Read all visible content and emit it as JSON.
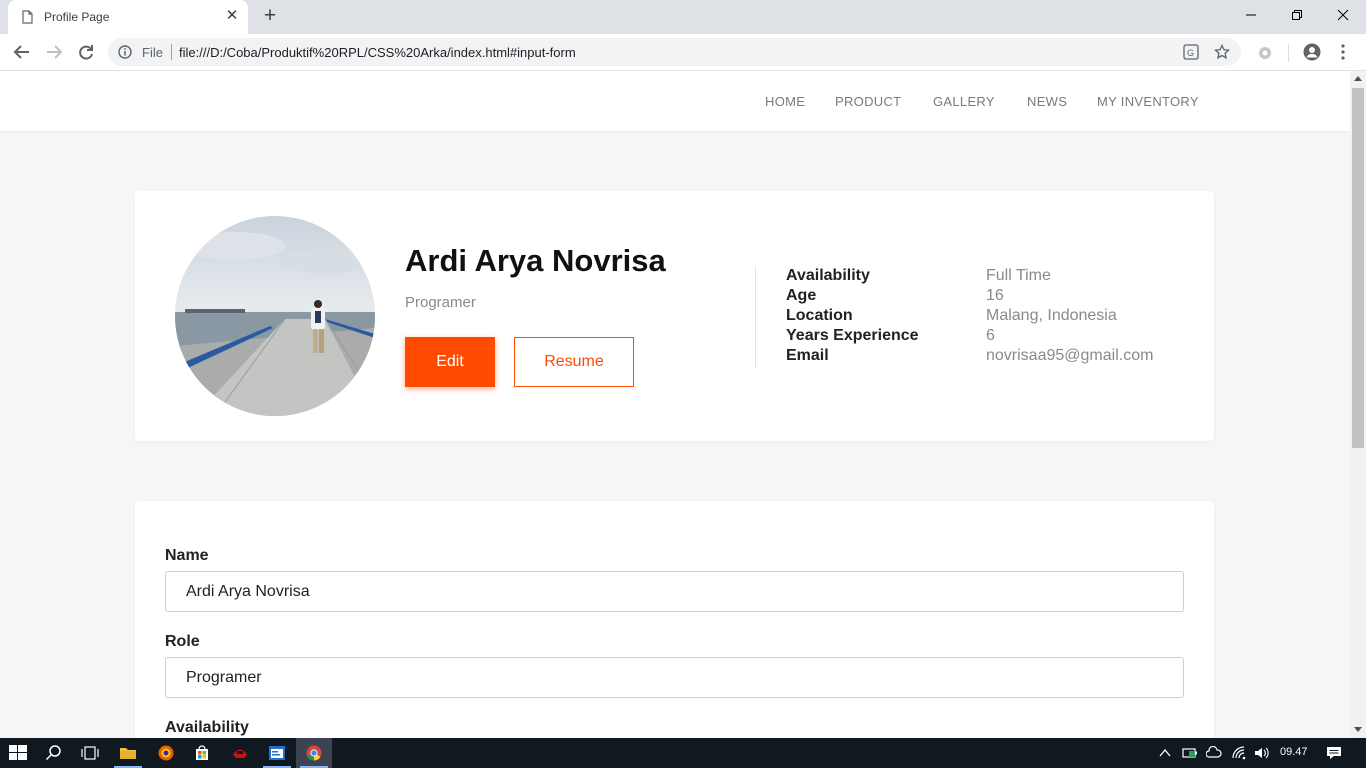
{
  "browser": {
    "tab_title": "Profile Page",
    "omnibox_scheme": "File",
    "url": "file:///D:/Coba/Produktif%20RPL/CSS%20Arka/index.html#input-form"
  },
  "nav": {
    "items": [
      "HOME",
      "PRODUCT",
      "GALLERY",
      "NEWS",
      "MY INVENTORY"
    ]
  },
  "profile": {
    "name": "Ardi Arya Novrisa",
    "role": "Programer",
    "edit_label": "Edit",
    "resume_label": "Resume",
    "details": [
      {
        "label": "Availability",
        "value": "Full Time"
      },
      {
        "label": "Age",
        "value": "16"
      },
      {
        "label": "Location",
        "value": "Malang, Indonesia"
      },
      {
        "label": "Years Experience",
        "value": "6"
      },
      {
        "label": "Email",
        "value": "novrisaa95@gmail.com"
      }
    ]
  },
  "form": {
    "name_label": "Name",
    "name_value": "Ardi Arya Novrisa",
    "role_label": "Role",
    "role_value": "Programer",
    "availability_label": "Availability"
  },
  "taskbar": {
    "clock": "09.47"
  },
  "colors": {
    "accent": "#ff4a00",
    "page_bg": "#f4f6f8"
  }
}
